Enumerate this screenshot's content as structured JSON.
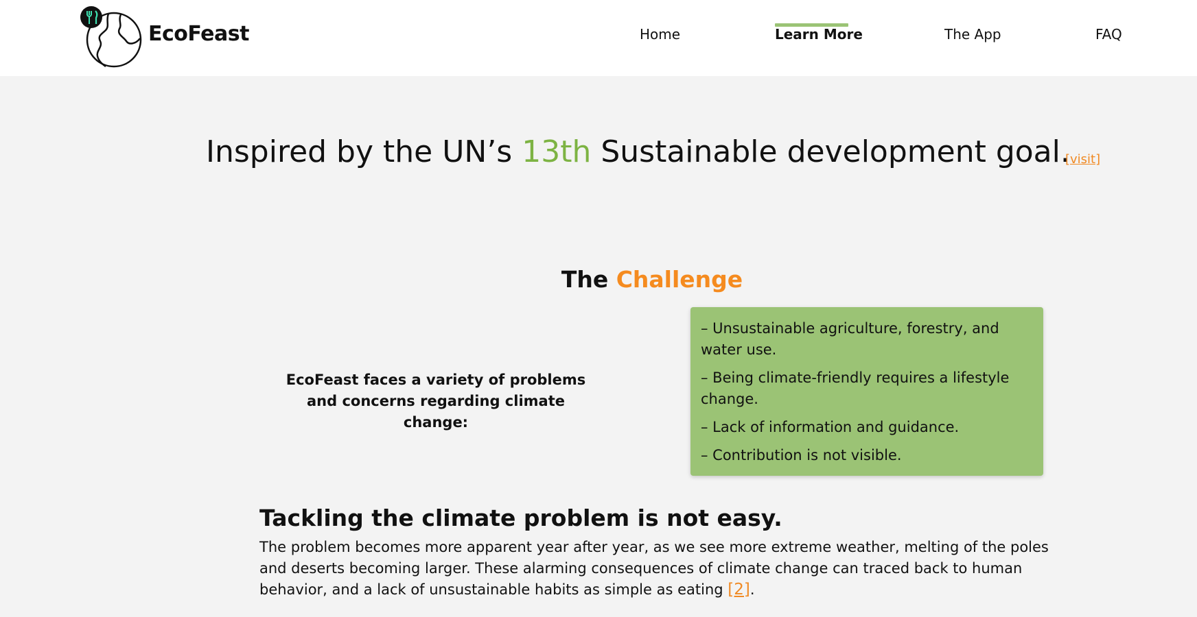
{
  "header": {
    "brand": "EcoFeast",
    "nav": [
      {
        "label": "Home",
        "active": false
      },
      {
        "label": "Learn More",
        "active": true
      },
      {
        "label": "The App",
        "active": false
      },
      {
        "label": "FAQ",
        "active": false
      }
    ]
  },
  "hero": {
    "before": "Inspired by the UN’s ",
    "highlight": "13th",
    "after": " Sustainable development goal.",
    "link": "[visit]"
  },
  "challenge": {
    "title_plain": "The ",
    "title_highlight": "Challenge",
    "intro": "EcoFeast faces a variety of problems and concerns regarding climate change:",
    "items": [
      "– Unsustainable agriculture, forestry, and water use.",
      "– Being climate-friendly requires a lifestyle change.",
      "– Lack of information and guidance.",
      "– Contribution is not visible."
    ]
  },
  "tackle": {
    "title": "Tackling the climate problem is not easy.",
    "body": "The problem becomes more apparent year after year, as we see more extreme weather, melting of the poles and deserts becoming larger. These alarming consequences of climate change can traced back to human behavior, and a lack of unsustainable habits as simple as eating ",
    "ref": "[2]",
    "end": "."
  },
  "colors": {
    "accent_green": "#9bc375",
    "highlight_green": "#7db343",
    "accent_orange": "#f58b1f",
    "background": "#f3f3f3"
  },
  "icons": {
    "logo": "globe-with-fork-knife-icon"
  }
}
